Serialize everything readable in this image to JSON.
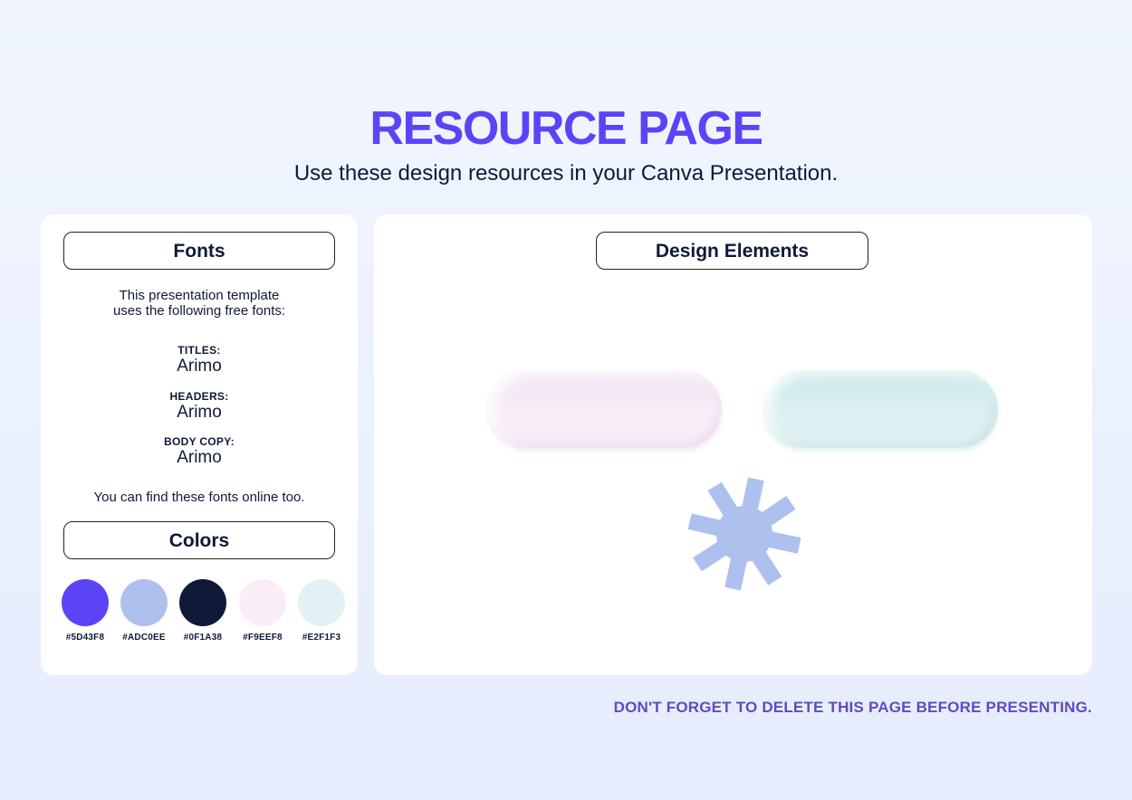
{
  "page": {
    "title": "RESOURCE PAGE",
    "subtitle": "Use these design resources in your Canva Presentation.",
    "footer_note": "DON'T FORGET TO DELETE THIS PAGE BEFORE PRESENTING."
  },
  "fonts": {
    "header": "Fonts",
    "intro_line1": "This presentation template",
    "intro_line2": "uses the following free fonts:",
    "items": [
      {
        "label": "TITLES:",
        "name": "Arimo"
      },
      {
        "label": "HEADERS:",
        "name": "Arimo"
      },
      {
        "label": "BODY COPY:",
        "name": "Arimo"
      }
    ],
    "find_text": "You can find these fonts online too."
  },
  "colors": {
    "header": "Colors",
    "swatches": [
      {
        "hex": "#5D43F8",
        "color": "#5D43F8"
      },
      {
        "hex": "#ADC0EE",
        "color": "#ADC0EE"
      },
      {
        "hex": "#0F1A38",
        "color": "#0F1A38"
      },
      {
        "hex": "#F9EEF8",
        "color": "#F9EEF8"
      },
      {
        "hex": "#E2F1F3",
        "color": "#E2F1F3"
      }
    ]
  },
  "design_elements": {
    "header": "Design Elements",
    "asterisk_color": "#ADC0EE"
  },
  "theme": {
    "accent": "#5D43F8",
    "footer_color": "#5E4BC0",
    "text": "#0F1A38"
  }
}
